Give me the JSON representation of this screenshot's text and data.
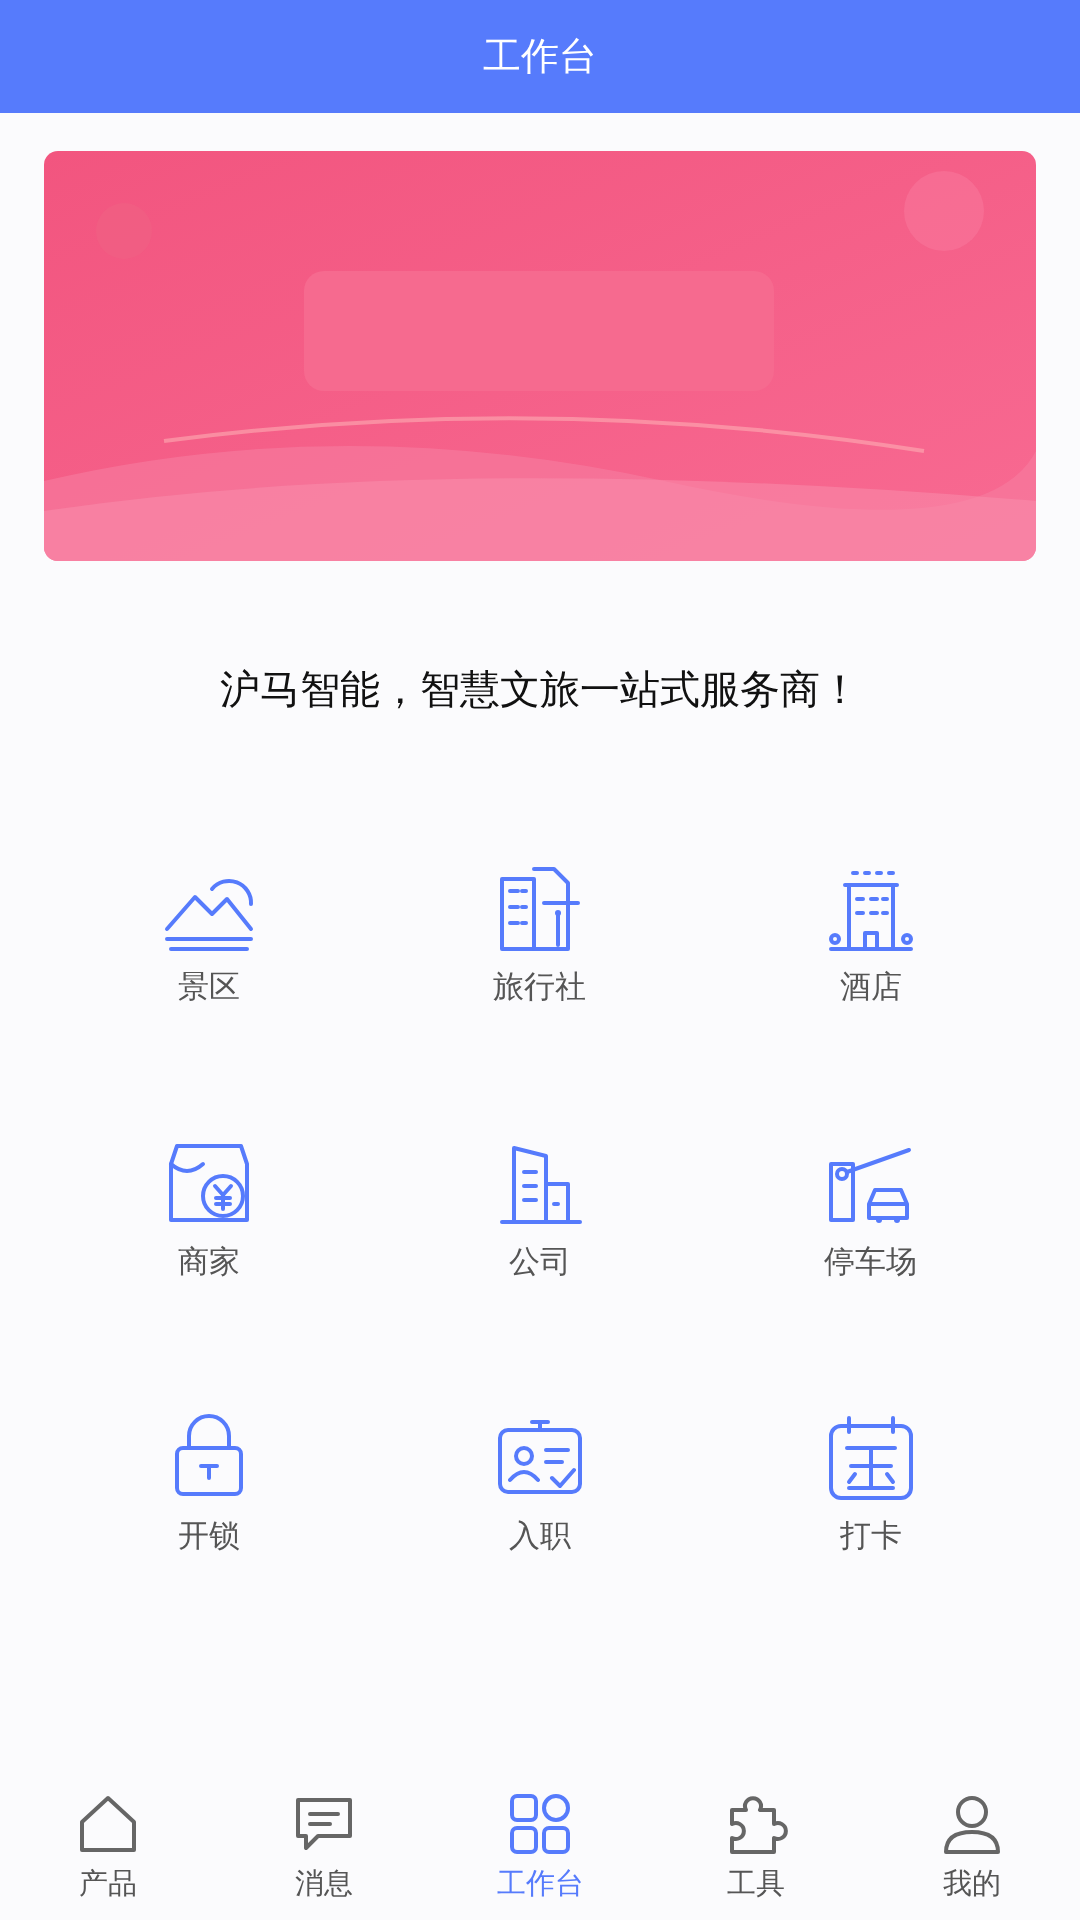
{
  "header": {
    "title": "工作台"
  },
  "slogan": "沪马智能，智慧文旅一站式服务商！",
  "grid": [
    {
      "label": "景区"
    },
    {
      "label": "旅行社"
    },
    {
      "label": "酒店"
    },
    {
      "label": "商家"
    },
    {
      "label": "公司"
    },
    {
      "label": "停车场"
    },
    {
      "label": "开锁"
    },
    {
      "label": "入职"
    },
    {
      "label": "打卡"
    }
  ],
  "tabbar": [
    {
      "label": "产品",
      "selected": false
    },
    {
      "label": "消息",
      "selected": false
    },
    {
      "label": "工作台",
      "selected": true
    },
    {
      "label": "工具",
      "selected": false
    },
    {
      "label": "我的",
      "selected": false
    }
  ]
}
